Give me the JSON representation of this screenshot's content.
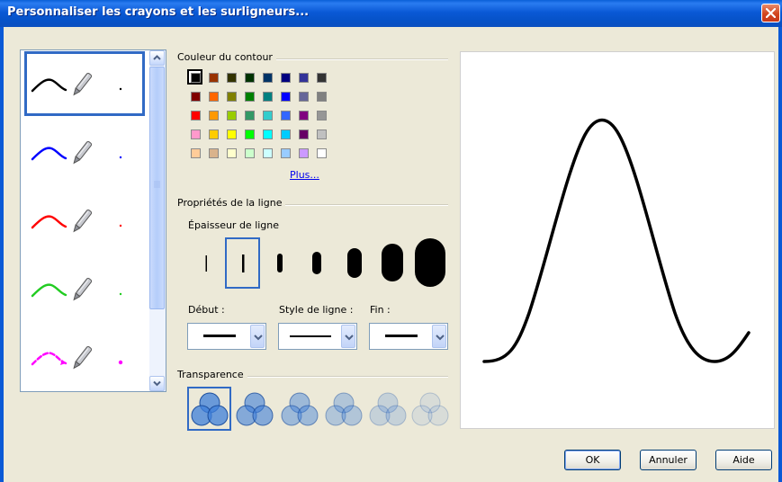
{
  "window": {
    "title": "Personnaliser les crayons et les surligneurs..."
  },
  "pens": [
    {
      "color": "#000000",
      "style": "solid",
      "selected": true
    },
    {
      "color": "#0000ff",
      "style": "solid",
      "selected": false
    },
    {
      "color": "#ff0000",
      "style": "solid",
      "selected": false
    },
    {
      "color": "#22cc22",
      "style": "solid",
      "selected": false
    },
    {
      "color": "#ff00ff",
      "style": "dashed-arrow",
      "selected": false
    }
  ],
  "outline_color": {
    "label": "Couleur du contour",
    "selected": "#000000",
    "rows": [
      [
        "#000000",
        "#993300",
        "#333300",
        "#003300",
        "#003366",
        "#000080",
        "#333399",
        "#333333"
      ],
      [
        "#800000",
        "#ff6600",
        "#808000",
        "#008000",
        "#008080",
        "#0000ff",
        "#666699",
        "#808080"
      ],
      [
        "#ff0000",
        "#ff9900",
        "#99cc00",
        "#339966",
        "#33cccc",
        "#3366ff",
        "#800080",
        "#969696"
      ],
      [
        "#ff99cc",
        "#ffcc00",
        "#ffff00",
        "#00ff00",
        "#00ffff",
        "#00ccff",
        "#660066",
        "#c0c0c0"
      ],
      [
        "#ffcc99",
        "#d9b38c",
        "#ffffcc",
        "#ccffcc",
        "#ccffff",
        "#99ccff",
        "#cc99ff",
        "#ffffff"
      ]
    ],
    "more_link": "Plus..."
  },
  "line_props": {
    "label": "Propriétés de la ligne",
    "thickness_label": "Épaisseur de ligne",
    "selected_thickness_index": 1,
    "start_label": "Début :",
    "style_label": "Style de ligne :",
    "end_label": "Fin :"
  },
  "transparency": {
    "label": "Transparence",
    "levels": [
      1.0,
      0.8,
      0.6,
      0.45,
      0.3,
      0.15
    ],
    "selected_index": 0
  },
  "buttons": {
    "ok": "OK",
    "cancel": "Annuler",
    "help": "Aide"
  },
  "icons": {
    "close": "close-icon",
    "scroll_up": "chevron-up-icon",
    "scroll_down": "chevron-down-icon",
    "dropdown": "chevron-down-icon",
    "pen": "pen-icon"
  }
}
